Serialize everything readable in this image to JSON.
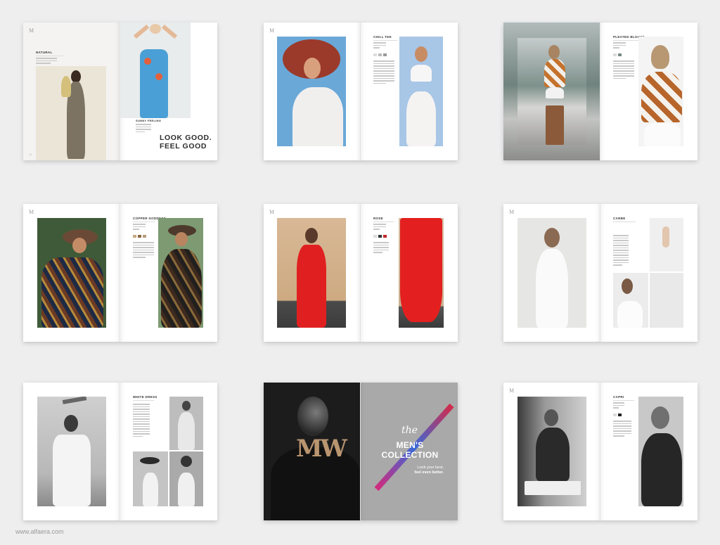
{
  "watermark": "www.alfaera.com",
  "logo_glyph": "M",
  "spreads": {
    "s1": {
      "left_heading": "NATURAL",
      "right_heading": "SUNNY FEELING",
      "tagline_line1": "LOOK GOOD.",
      "tagline_line2": "FEEL  GOOD"
    },
    "s2": {
      "right_heading": "CHILL TEE"
    },
    "s3": {
      "right_heading": "PLEATED BLOUSE"
    },
    "s4": {
      "right_heading": "COPPER GODDESS"
    },
    "s5": {
      "right_heading": "ROSE"
    },
    "s6": {
      "right_heading": "CARBE"
    },
    "s7": {
      "right_heading": "WHITE DRESS"
    },
    "s8": {
      "logo": "MW",
      "the": "the",
      "title_line1": "MEN'S",
      "title_line2": "COLLECTION",
      "sub_line1": "Look your best,",
      "sub_line2": "feel even better."
    },
    "s9": {
      "right_heading": "CAPRI"
    }
  },
  "colors": {
    "background": "#eeeeef",
    "gold_accent": "#c9a774",
    "red_dress": "#e02020",
    "gray_cover": "#a9a9a9",
    "dark_cover": "#1c1c1c"
  }
}
